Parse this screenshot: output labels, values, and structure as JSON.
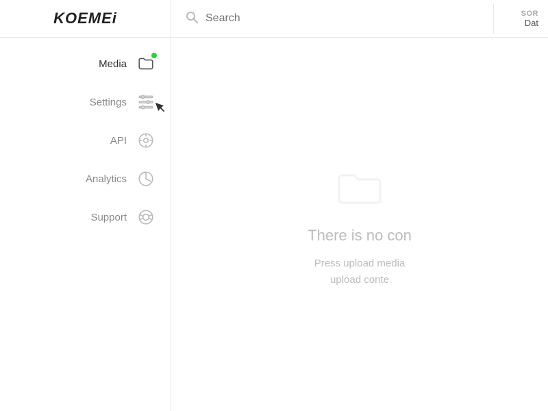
{
  "logo": {
    "text": "KOEMEi"
  },
  "search": {
    "placeholder": "Search"
  },
  "sort": {
    "label": "SOR",
    "value": "Dat"
  },
  "sidebar": {
    "items": [
      {
        "id": "media",
        "label": "Media",
        "icon": "folder-icon",
        "active": true,
        "badge": true
      },
      {
        "id": "settings",
        "label": "Settings",
        "icon": "settings-icon",
        "active": false,
        "badge": false
      },
      {
        "id": "api",
        "label": "API",
        "icon": "api-icon",
        "active": false,
        "badge": false
      },
      {
        "id": "analytics",
        "label": "Analytics",
        "icon": "analytics-icon",
        "active": false,
        "badge": false
      },
      {
        "id": "support",
        "label": "Support",
        "icon": "support-icon",
        "active": false,
        "badge": false
      }
    ]
  },
  "content": {
    "empty_title": "There is no con",
    "empty_desc_line1": "Press upload media",
    "empty_desc_line2": "upload conte"
  }
}
